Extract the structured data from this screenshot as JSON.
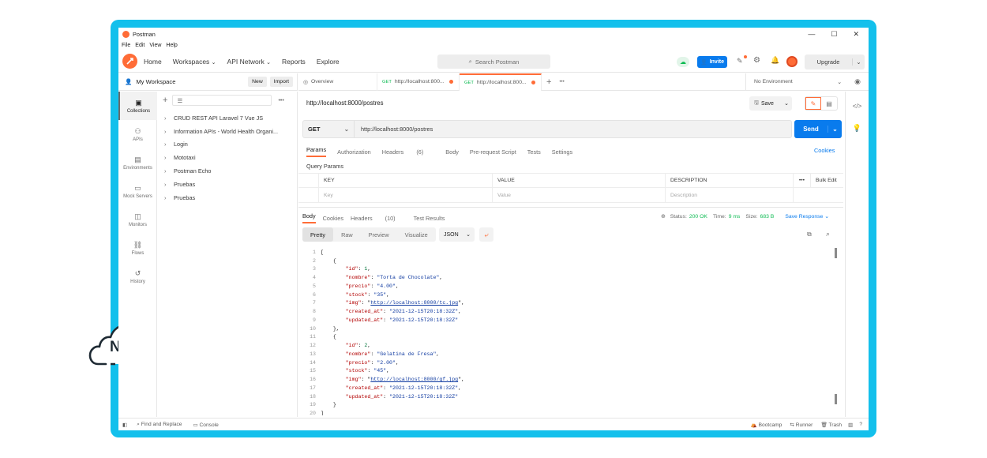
{
  "window": {
    "app_title": "Postman",
    "controls": {
      "minimize": "—",
      "maximize": "☐",
      "close": "✕"
    }
  },
  "menu": [
    "File",
    "Edit",
    "View",
    "Help"
  ],
  "header": {
    "nav": [
      {
        "label": "Home"
      },
      {
        "label": "Workspaces",
        "has_dropdown": true
      },
      {
        "label": "API Network",
        "has_dropdown": true
      },
      {
        "label": "Reports"
      },
      {
        "label": "Explore"
      }
    ],
    "search_placeholder": "Search Postman",
    "invite_label": "Invite",
    "upgrade_label": "Upgrade"
  },
  "workspace": {
    "name": "My Workspace",
    "new_label": "New",
    "import_label": "Import"
  },
  "icon_rail": [
    {
      "label": "Collections",
      "icon": "collections-icon",
      "active": true
    },
    {
      "label": "APIs",
      "icon": "apis-icon",
      "active": false
    },
    {
      "label": "Environments",
      "icon": "environments-icon",
      "active": false
    },
    {
      "label": "Mock Servers",
      "icon": "mock-servers-icon",
      "active": false
    },
    {
      "label": "Monitors",
      "icon": "monitors-icon",
      "active": false
    },
    {
      "label": "Flows",
      "icon": "flows-icon",
      "active": false
    },
    {
      "label": "History",
      "icon": "history-icon",
      "active": false
    }
  ],
  "collections": [
    "CRUD REST API Laravel 7 Vue JS",
    "Information APIs - World Health Organi...",
    "Login",
    "Mototaxi",
    "Postman Echo",
    "Pruebas",
    "Pruebas"
  ],
  "tabs": [
    {
      "label": "Overview",
      "method": "",
      "unsaved": false,
      "active": false
    },
    {
      "label": "http://localhost:800...",
      "method": "GET",
      "unsaved": true,
      "active": false
    },
    {
      "label": "http://localhost:800...",
      "method": "GET",
      "unsaved": true,
      "active": true
    }
  ],
  "environment": "No Environment",
  "request": {
    "title": "http://localhost:8000/postres",
    "save_label": "Save",
    "method": "GET",
    "url": "http://localhost:8000/postres",
    "send_label": "Send",
    "subtabs": [
      {
        "label": "Params",
        "active": true
      },
      {
        "label": "Authorization"
      },
      {
        "label": "Headers",
        "count": "(6)"
      },
      {
        "label": "Body"
      },
      {
        "label": "Pre-request Script"
      },
      {
        "label": "Tests"
      },
      {
        "label": "Settings"
      }
    ],
    "cookies_label": "Cookies",
    "query_params_label": "Query Params",
    "params_table": {
      "headers": [
        "KEY",
        "VALUE",
        "DESCRIPTION"
      ],
      "placeholders": [
        "Key",
        "Value",
        "Description"
      ],
      "bulk_edit_label": "Bulk Edit",
      "more_label": "•••"
    }
  },
  "response": {
    "tabs": [
      {
        "label": "Body",
        "active": true
      },
      {
        "label": "Cookies"
      },
      {
        "label": "Headers",
        "count": "(10)"
      },
      {
        "label": "Test Results"
      }
    ],
    "status_label": "Status:",
    "status_value": "200 OK",
    "time_label": "Time:",
    "time_value": "9 ms",
    "size_label": "Size:",
    "size_value": "683 B",
    "save_response_label": "Save Response",
    "views": [
      "Pretty",
      "Raw",
      "Preview",
      "Visualize"
    ],
    "format": "JSON",
    "code_lines": [
      [
        {
          "t": "[",
          "c": "p"
        }
      ],
      [
        {
          "t": "    {",
          "c": "p"
        }
      ],
      [
        {
          "t": "        ",
          "c": "p"
        },
        {
          "t": "\"id\"",
          "c": "k"
        },
        {
          "t": ": ",
          "c": "p"
        },
        {
          "t": "1",
          "c": "n"
        },
        {
          "t": ",",
          "c": "p"
        }
      ],
      [
        {
          "t": "        ",
          "c": "p"
        },
        {
          "t": "\"nombre\"",
          "c": "k"
        },
        {
          "t": ": ",
          "c": "p"
        },
        {
          "t": "\"Torta de Chocolate\"",
          "c": "s"
        },
        {
          "t": ",",
          "c": "p"
        }
      ],
      [
        {
          "t": "        ",
          "c": "p"
        },
        {
          "t": "\"precio\"",
          "c": "k"
        },
        {
          "t": ": ",
          "c": "p"
        },
        {
          "t": "\"4.00\"",
          "c": "s"
        },
        {
          "t": ",",
          "c": "p"
        }
      ],
      [
        {
          "t": "        ",
          "c": "p"
        },
        {
          "t": "\"stock\"",
          "c": "k"
        },
        {
          "t": ": ",
          "c": "p"
        },
        {
          "t": "\"35\"",
          "c": "s"
        },
        {
          "t": ",",
          "c": "p"
        }
      ],
      [
        {
          "t": "        ",
          "c": "p"
        },
        {
          "t": "\"img\"",
          "c": "k"
        },
        {
          "t": ": \"",
          "c": "p"
        },
        {
          "t": "http://localhost:8000/tc.jpg",
          "c": "u"
        },
        {
          "t": "\",",
          "c": "p"
        }
      ],
      [
        {
          "t": "        ",
          "c": "p"
        },
        {
          "t": "\"created_at\"",
          "c": "k"
        },
        {
          "t": ": ",
          "c": "p"
        },
        {
          "t": "\"2021-12-15T20:18:32Z\"",
          "c": "s"
        },
        {
          "t": ",",
          "c": "p"
        }
      ],
      [
        {
          "t": "        ",
          "c": "p"
        },
        {
          "t": "\"updated_at\"",
          "c": "k"
        },
        {
          "t": ": ",
          "c": "p"
        },
        {
          "t": "\"2021-12-15T20:18:32Z\"",
          "c": "s"
        }
      ],
      [
        {
          "t": "    },",
          "c": "p"
        }
      ],
      [
        {
          "t": "    {",
          "c": "p"
        }
      ],
      [
        {
          "t": "        ",
          "c": "p"
        },
        {
          "t": "\"id\"",
          "c": "k"
        },
        {
          "t": ": ",
          "c": "p"
        },
        {
          "t": "2",
          "c": "n"
        },
        {
          "t": ",",
          "c": "p"
        }
      ],
      [
        {
          "t": "        ",
          "c": "p"
        },
        {
          "t": "\"nombre\"",
          "c": "k"
        },
        {
          "t": ": ",
          "c": "p"
        },
        {
          "t": "\"Gelatina de Fresa\"",
          "c": "s"
        },
        {
          "t": ",",
          "c": "p"
        }
      ],
      [
        {
          "t": "        ",
          "c": "p"
        },
        {
          "t": "\"precio\"",
          "c": "k"
        },
        {
          "t": ": ",
          "c": "p"
        },
        {
          "t": "\"2.00\"",
          "c": "s"
        },
        {
          "t": ",",
          "c": "p"
        }
      ],
      [
        {
          "t": "        ",
          "c": "p"
        },
        {
          "t": "\"stock\"",
          "c": "k"
        },
        {
          "t": ": ",
          "c": "p"
        },
        {
          "t": "\"45\"",
          "c": "s"
        },
        {
          "t": ",",
          "c": "p"
        }
      ],
      [
        {
          "t": "        ",
          "c": "p"
        },
        {
          "t": "\"img\"",
          "c": "k"
        },
        {
          "t": ": \"",
          "c": "p"
        },
        {
          "t": "http://localhost:8000/gf.jpg",
          "c": "u"
        },
        {
          "t": "\",",
          "c": "p"
        }
      ],
      [
        {
          "t": "        ",
          "c": "p"
        },
        {
          "t": "\"created_at\"",
          "c": "k"
        },
        {
          "t": ": ",
          "c": "p"
        },
        {
          "t": "\"2021-12-15T20:18:32Z\"",
          "c": "s"
        },
        {
          "t": ",",
          "c": "p"
        }
      ],
      [
        {
          "t": "        ",
          "c": "p"
        },
        {
          "t": "\"updated_at\"",
          "c": "k"
        },
        {
          "t": ": ",
          "c": "p"
        },
        {
          "t": "\"2021-12-15T20:18:32Z\"",
          "c": "s"
        }
      ],
      [
        {
          "t": "    }",
          "c": "p"
        }
      ],
      [
        {
          "t": "]",
          "c": "p"
        }
      ]
    ]
  },
  "statusbar": {
    "find_replace_label": "Find and Replace",
    "console_label": "Console",
    "bootcamp_label": "Bootcamp",
    "runner_label": "Runner",
    "trash_label": "Trash"
  },
  "logo_text": "NC",
  "colors": {
    "frame": "#13c0ec",
    "brand_orange": "#ff6c37",
    "primary_blue": "#097bed",
    "status_green": "#0cbb52"
  }
}
